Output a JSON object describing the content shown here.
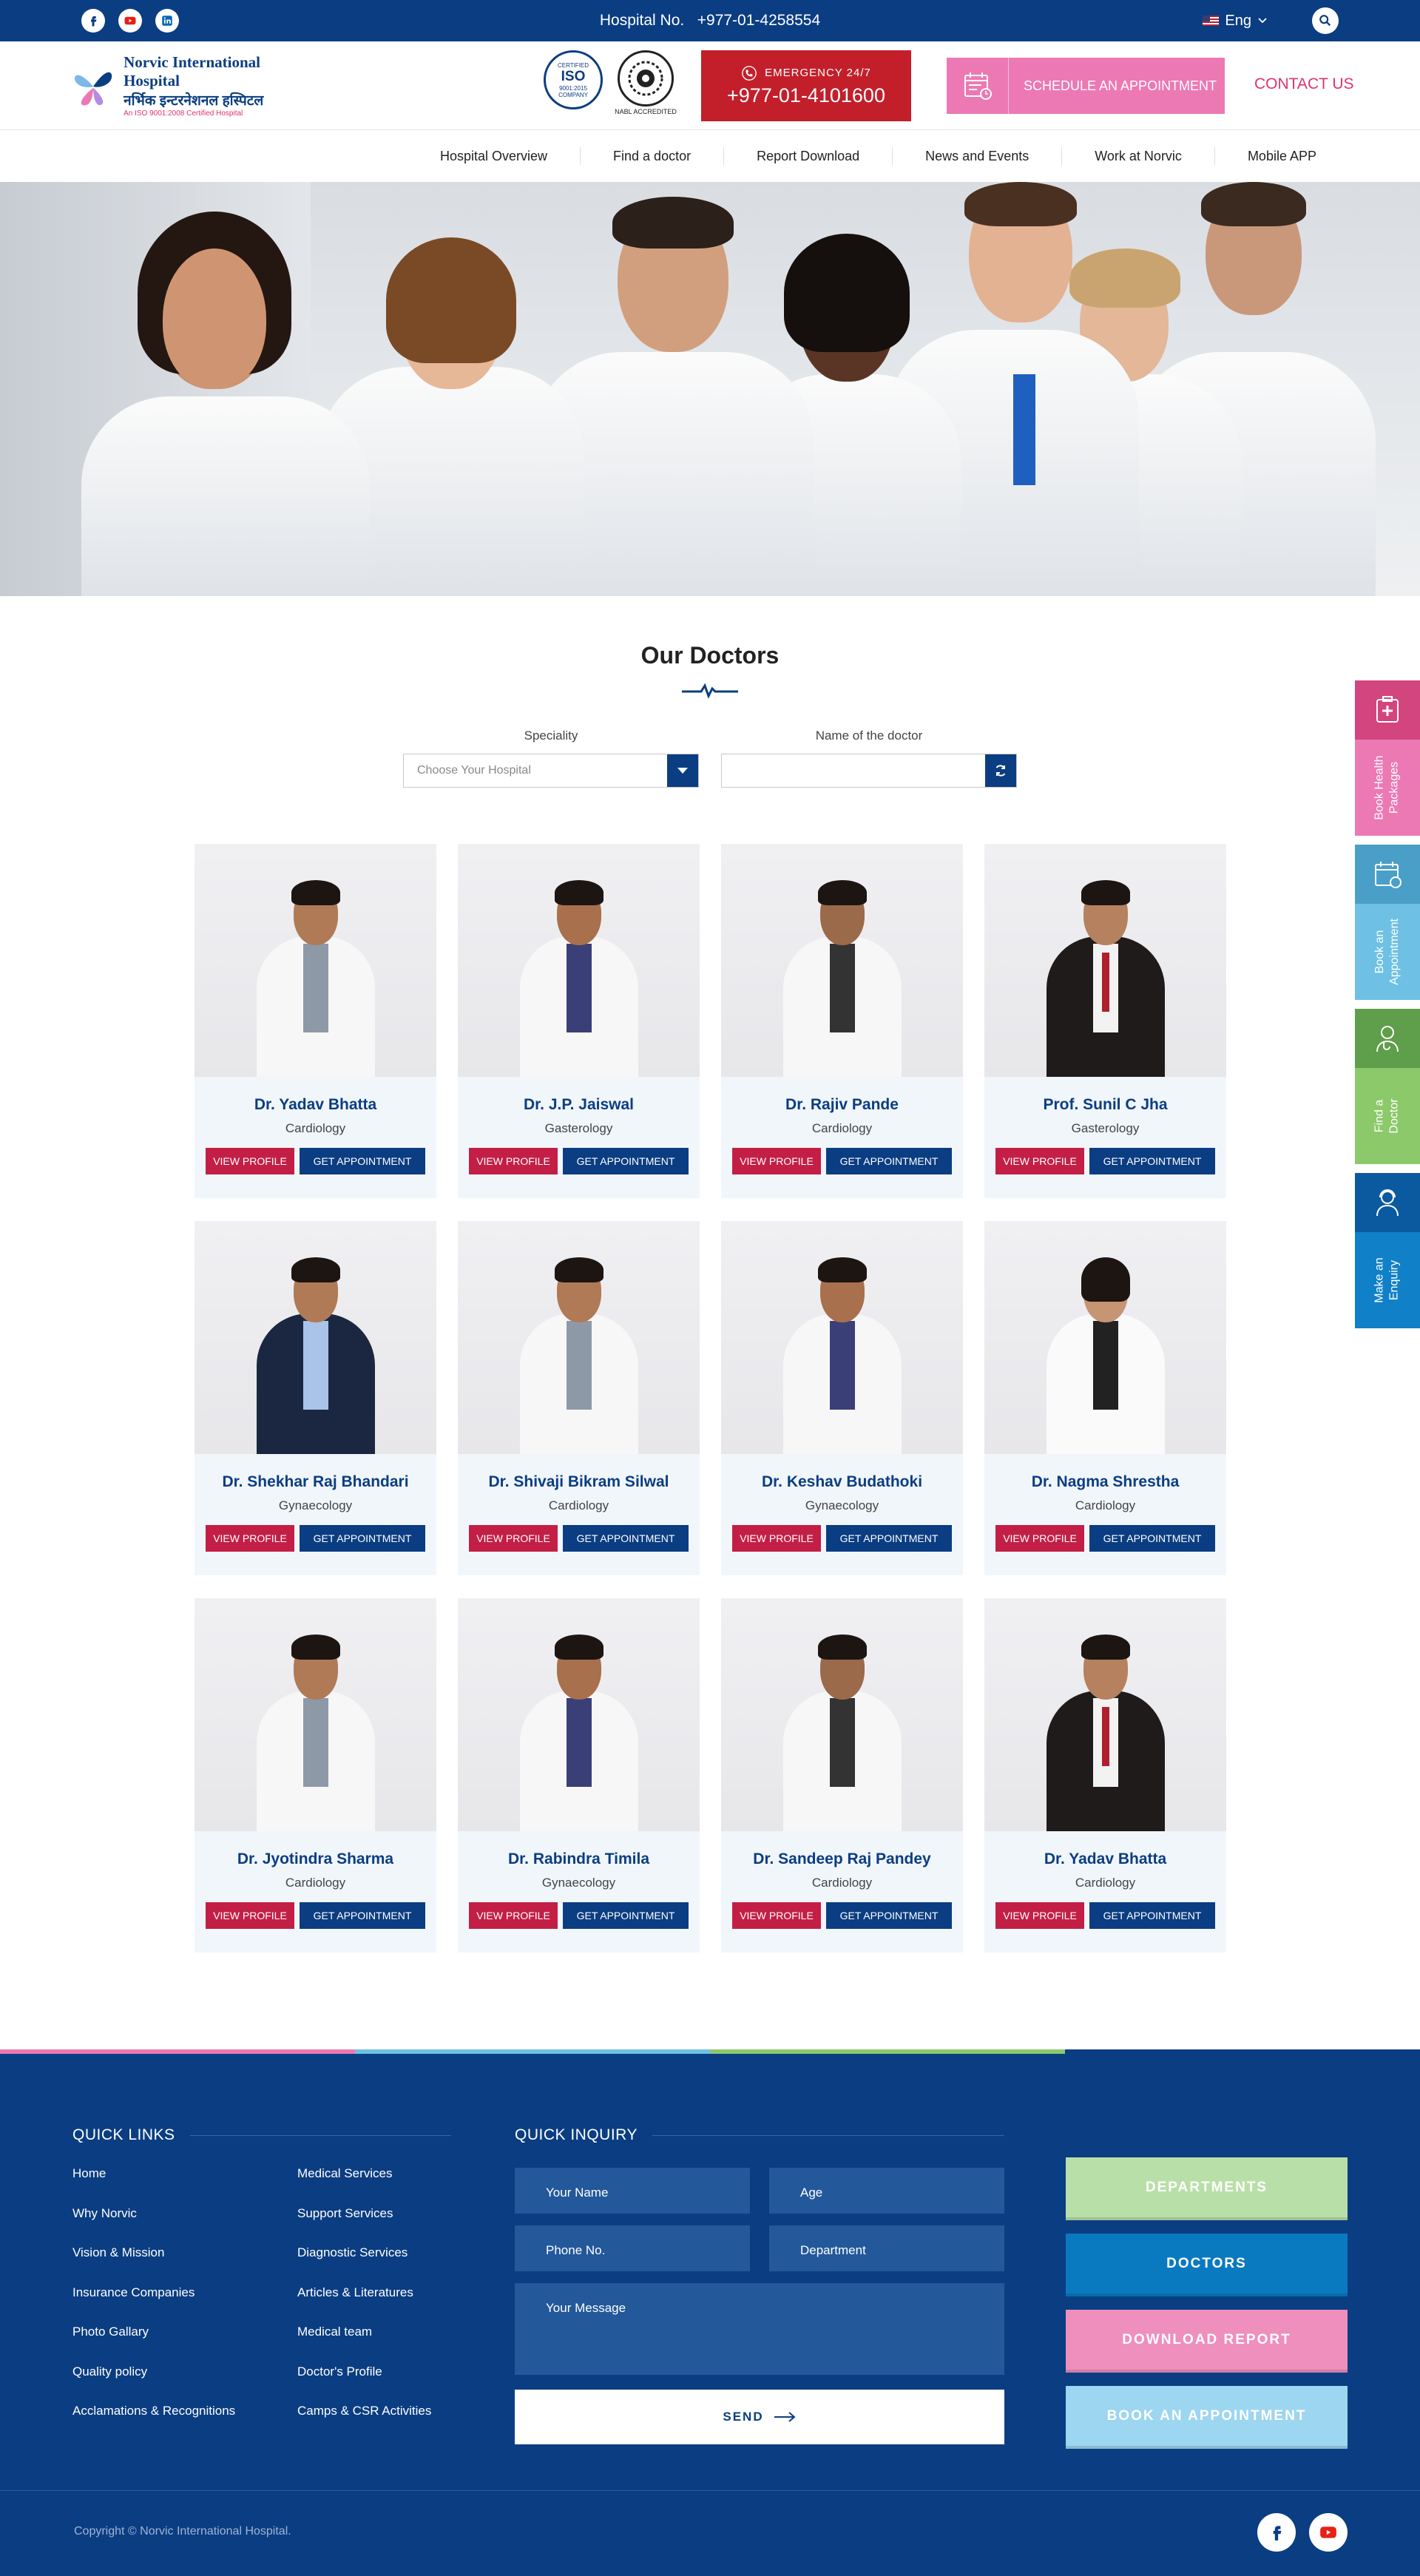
{
  "topbar": {
    "hospital_no_label": "Hospital No.",
    "hospital_no": "+977-01-4258554",
    "language": "Eng"
  },
  "header": {
    "logo_en": "Norvic International Hospital",
    "logo_np": "नर्भिक इन्टरनेशनल हस्पिटल",
    "logo_tag": "An ISO 9001:2008 Certified Hospital",
    "iso_top": "CERTIFIED",
    "iso_big": "ISO",
    "iso_mid": "9001:2015",
    "iso_bottom": "COMPANY",
    "nabl_label": "NABL ACCREDITED",
    "emergency_label": "EMERGENCY 24/7",
    "emergency_number": "+977-01-4101600",
    "schedule_label": "SCHEDULE AN APPOINTMENT",
    "contact_label": "CONTACT US"
  },
  "nav": [
    "Hospital Overview",
    "Find a doctor",
    "Report Download",
    "News and Events",
    "Work at Norvic",
    "Mobile APP"
  ],
  "doctors_section": {
    "title": "Our Doctors",
    "speciality_label": "Speciality",
    "speciality_placeholder": "Choose Your Hospital",
    "name_label": "Name of the doctor",
    "name_value": "",
    "view_profile_label": "VIEW PROFILE",
    "get_appointment_label": "GET APPOINTMENT"
  },
  "doctors": [
    {
      "name": "Dr. Yadav Bhatta",
      "speciality": "Cardiology"
    },
    {
      "name": "Dr. J.P. Jaiswal",
      "speciality": "Gasterology"
    },
    {
      "name": "Dr. Rajiv Pande",
      "speciality": "Cardiology"
    },
    {
      "name": "Prof. Sunil C Jha",
      "speciality": "Gasterology"
    },
    {
      "name": "Dr. Shekhar Raj Bhandari",
      "speciality": "Gynaecology"
    },
    {
      "name": "Dr. Shivaji Bikram Silwal",
      "speciality": "Cardiology"
    },
    {
      "name": "Dr. Keshav Budathoki",
      "speciality": "Gynaecology"
    },
    {
      "name": "Dr. Nagma Shrestha",
      "speciality": "Cardiology"
    },
    {
      "name": "Dr. Jyotindra Sharma",
      "speciality": "Cardiology"
    },
    {
      "name": "Dr. Rabindra Timila",
      "speciality": "Gynaecology"
    },
    {
      "name": "Dr. Sandeep Raj Pandey",
      "speciality": "Cardiology"
    },
    {
      "name": "Dr. Yadav Bhatta",
      "speciality": "Cardiology"
    }
  ],
  "side_tabs": [
    {
      "label_1": "Book Health",
      "label_2": "Packages",
      "top_color": "#d2457f",
      "bottom_color": "#ec79b4"
    },
    {
      "label_1": "Book an",
      "label_2": "Appointment",
      "top_color": "#4a9fc8",
      "bottom_color": "#6ec1e4"
    },
    {
      "label_1": "Find a",
      "label_2": "Doctor",
      "top_color": "#5f9e4a",
      "bottom_color": "#8cc96b"
    },
    {
      "label_1": "Make an",
      "label_2": "Enquiry",
      "top_color": "#0b5aa0",
      "bottom_color": "#1080c8"
    }
  ],
  "footer": {
    "quick_links_title": "QUICK LINKS",
    "quick_links": [
      "Home",
      "Medical Services",
      "Why Norvic",
      "Support Services",
      "Vision & Mission",
      "Diagnostic Services",
      "Insurance Companies",
      "Articles & Literatures",
      "Photo Gallary",
      "Medical team",
      "Quality policy",
      "Doctor's Profile",
      "Acclamations & Recognitions",
      "Camps & CSR Activities"
    ],
    "inquiry_title": "QUICK INQUIRY",
    "inquiry_fields": {
      "name": "Your Name",
      "age": "Age",
      "phone": "Phone No.",
      "department": "Department",
      "message": "Your Message"
    },
    "send_label": "SEND",
    "buttons": [
      {
        "label": "DEPARTMENTS",
        "color": "#b9dfa8"
      },
      {
        "label": "DOCTORS",
        "color": "#0a7ac0"
      },
      {
        "label": "DOWNLOAD REPORT",
        "color": "#ee8fbe"
      },
      {
        "label": "BOOK AN APPOINTMENT",
        "color": "#9dd6f0"
      }
    ],
    "copyright": "Copyright © Norvic International Hospital."
  },
  "colors": {
    "primary": "#0b3d82",
    "accent_red": "#c31f2b",
    "accent_pink": "#ec79b4"
  }
}
